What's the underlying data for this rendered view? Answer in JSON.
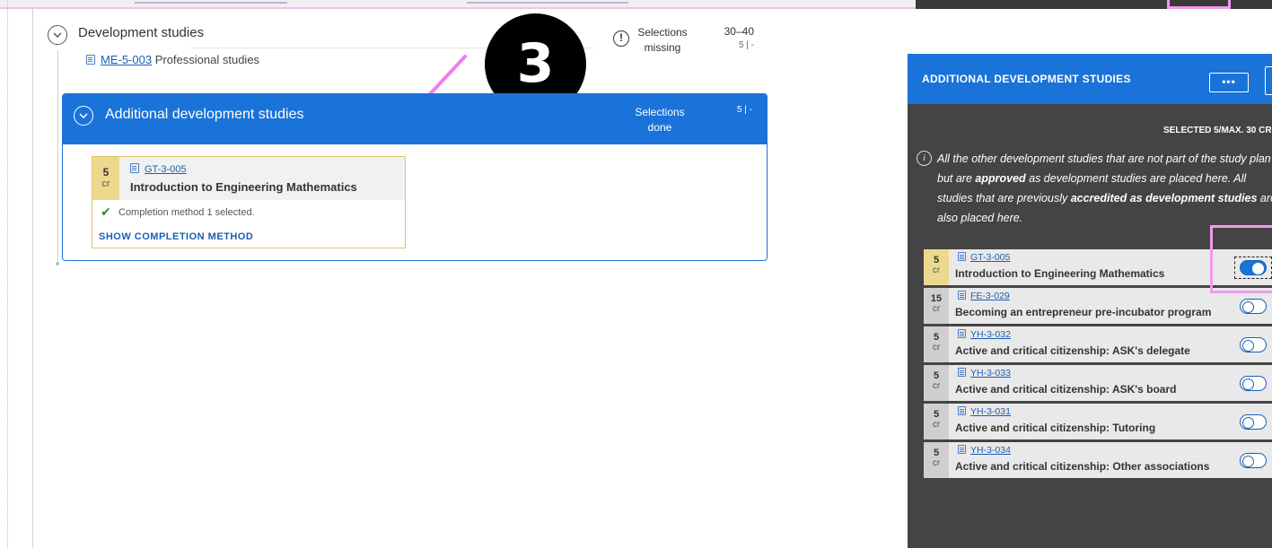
{
  "development_studies": {
    "title": "Development studies",
    "status_line1": "Selections",
    "status_line2": "missing",
    "credit_range": "30–40",
    "credit_sub": "5 | -",
    "professional": {
      "code": "ME-5-003",
      "name": "Professional studies"
    }
  },
  "step_marker": "3",
  "additional": {
    "title": "Additional development studies",
    "status_line1": "Selections",
    "status_line2": "done",
    "credit_sub": "5 | -",
    "card": {
      "credits": "5",
      "unit": "cr",
      "code": "GT-3-005",
      "name": "Introduction to Engineering Mathematics",
      "completion": "Completion method 1 selected.",
      "show_method": "SHOW COMPLETION METHOD"
    }
  },
  "panel": {
    "title": "ADDITIONAL DEVELOPMENT STUDIES",
    "more_label": "•••",
    "selected_label": "SELECTED 5/MAX. 30 CR",
    "note_parts": [
      "All the other development studies that are not part of the study plan but are ",
      "approved",
      " as development studies are placed here. All studies that are previously ",
      "accredited as development studies",
      " are also placed here."
    ],
    "courses": [
      {
        "credits": "5",
        "unit": "cr",
        "code": "GT-3-005",
        "name": "Introduction to Engineering Mathematics",
        "selected": true
      },
      {
        "credits": "15",
        "unit": "cr",
        "code": "FE-3-029",
        "name": "Becoming an entrepreneur pre-incubator program",
        "selected": false
      },
      {
        "credits": "5",
        "unit": "cr",
        "code": "YH-3-032",
        "name": "Active and critical citizenship: ASK's delegate",
        "selected": false
      },
      {
        "credits": "5",
        "unit": "cr",
        "code": "YH-3-033",
        "name": "Active and critical citizenship: ASK's board",
        "selected": false
      },
      {
        "credits": "5",
        "unit": "cr",
        "code": "YH-3-031",
        "name": "Active and critical citizenship: Tutoring",
        "selected": false
      },
      {
        "credits": "5",
        "unit": "cr",
        "code": "YH-3-034",
        "name": "Active and critical citizenship: Other associations",
        "selected": false
      }
    ]
  },
  "colors": {
    "accent": "#1a73d8",
    "selected_credit": "#ecd98e",
    "highlight": "#f09af0",
    "panel_bg": "#444444"
  }
}
